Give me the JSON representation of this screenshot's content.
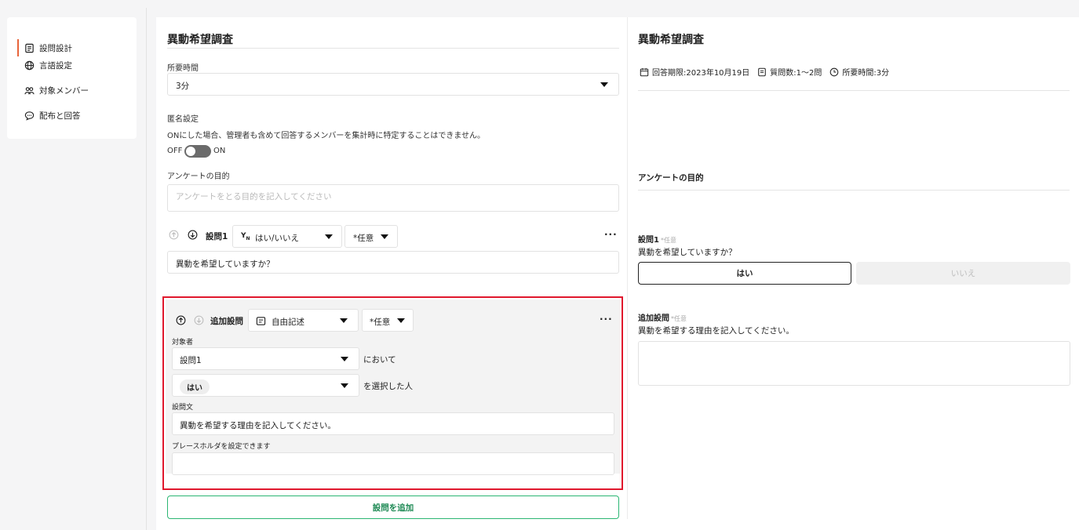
{
  "sidebar": {
    "items": [
      {
        "label": "設問設計",
        "icon": "document-icon"
      },
      {
        "label": "言語設定",
        "icon": "globe-icon"
      },
      {
        "label": "対象メンバー",
        "icon": "people-icon"
      },
      {
        "label": "配布と回答",
        "icon": "chat-icon"
      }
    ]
  },
  "form": {
    "title": "異動希望調査",
    "duration_label": "所要時間",
    "duration_value": "3分",
    "anon_label": "匿名設定",
    "anon_desc": "ONにした場合、管理者も含めて回答するメンバーを集計時に特定することはできません。",
    "toggle_off": "OFF",
    "toggle_on": "ON",
    "purpose_label": "アンケートの目的",
    "purpose_placeholder": "アンケートをとる目的を記入してください",
    "q1": {
      "label": "設問1",
      "type": "はい/いいえ",
      "required": "*任意",
      "text": "異動を希望していますか？"
    },
    "followup": {
      "label": "追加設問",
      "type": "自由記述",
      "required": "*任意",
      "target_label": "対象者",
      "target_question": "設問1",
      "target_suffix": "において",
      "target_answer": "はい",
      "answer_suffix": "を選択した人",
      "question_text_label": "設問文",
      "question_text": "異動を希望する理由を記入してください。",
      "placeholder_label": "プレースホルダを設定できます",
      "placeholder_value": ""
    },
    "add_button": "設問を追加"
  },
  "preview": {
    "title": "異動希望調査",
    "deadline": "回答期限:2023年10月19日",
    "question_count": "質問数:1〜2問",
    "duration": "所要時間:3分",
    "purpose_label": "アンケートの目的",
    "q1_label": "設問1",
    "q1_required": "*任意",
    "q1_text": "異動を希望していますか？",
    "yes": "はい",
    "no": "いいえ",
    "followup_label": "追加設問",
    "followup_required": "*任意",
    "followup_text": "異動を希望する理由を記入してください。"
  },
  "colors": {
    "accent": "#e8643a",
    "highlight_border": "#e0182d",
    "add_button": "#2bb673"
  }
}
